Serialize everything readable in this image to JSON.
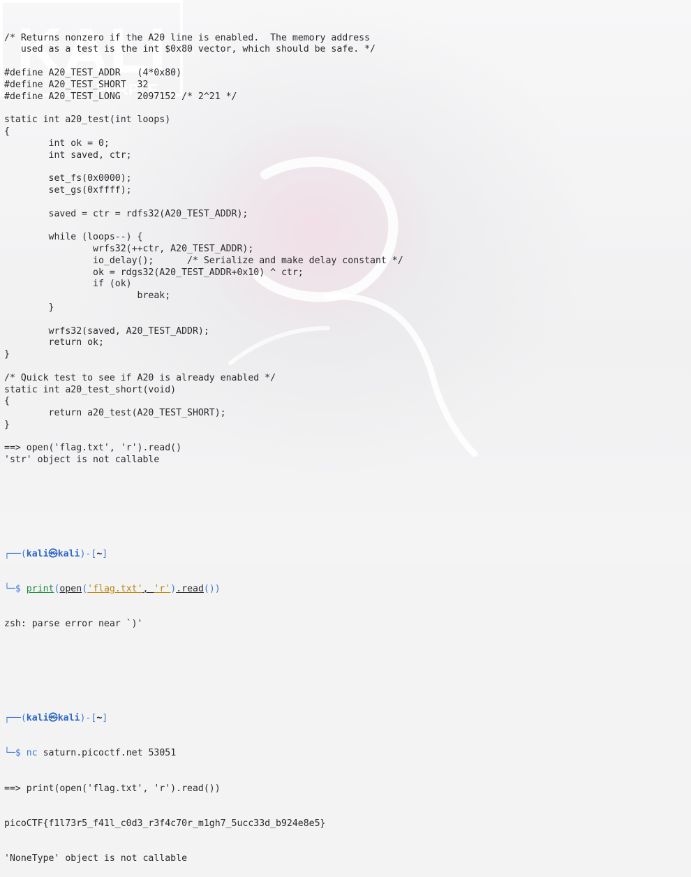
{
  "code": [
    "/* Returns nonzero if the A20 line is enabled.  The memory address",
    "   used as a test is the int $0x80 vector, which should be safe. */",
    "",
    "#define A20_TEST_ADDR   (4*0x80)",
    "#define A20_TEST_SHORT  32",
    "#define A20_TEST_LONG   2097152 /* 2^21 */",
    "",
    "static int a20_test(int loops)",
    "{",
    "        int ok = 0;",
    "        int saved, ctr;",
    "",
    "        set_fs(0x0000);",
    "        set_gs(0xffff);",
    "",
    "        saved = ctr = rdfs32(A20_TEST_ADDR);",
    "",
    "        while (loops--) {",
    "                wrfs32(++ctr, A20_TEST_ADDR);",
    "                io_delay();      /* Serialize and make delay constant */",
    "                ok = rdgs32(A20_TEST_ADDR+0x10) ^ ctr;",
    "                if (ok)",
    "                        break;",
    "        }",
    "",
    "        wrfs32(saved, A20_TEST_ADDR);",
    "        return ok;",
    "}",
    "",
    "/* Quick test to see if A20 is already enabled */",
    "static int a20_test_short(void)",
    "{",
    "        return a20_test(A20_TEST_SHORT);",
    "}",
    "",
    "==> open('flag.txt', 'r').read()",
    "'str' object is not callable"
  ],
  "session1": {
    "prompt_open": "┌──(",
    "user": "kali㉿kali",
    "prompt_mid": ")-[",
    "path": "~",
    "prompt_close": "]",
    "prompt_line2": "└─$ ",
    "cmd_builtin": "print",
    "p1": "(",
    "cmd_open": "open",
    "p2": "(",
    "cmd_arg1": "'flag.txt'",
    "comma": ", ",
    "cmd_arg2": "'r'",
    "p3": ")",
    "cmd_read": ".read",
    "p4": "())",
    "output": "zsh: parse error near `)'"
  },
  "session2": {
    "prompt_open": "┌──(",
    "user": "kali㉿kali",
    "prompt_mid": ")-[",
    "path": "~",
    "prompt_close": "]",
    "prompt_line2": "└─$ ",
    "cmd_nc": "nc",
    "cmd_args": " saturn.picoctf.net 53051",
    "output": [
      "==> print(open('flag.txt', 'r').read())",
      "picoCTF{f1l73r5_f41l_c0d3_r3f4c70r_m1gh7_5ucc33d_b924e8e5}",
      "'NoneType' object is not callable"
    ]
  },
  "wallpaper": {
    "logo_text": "KALI",
    "logo_subtext": "PURPLE"
  },
  "colors": {
    "background": "#f3f3f4",
    "text": "#2a2a2e",
    "prompt_blue": "#3a7bd5"
  }
}
